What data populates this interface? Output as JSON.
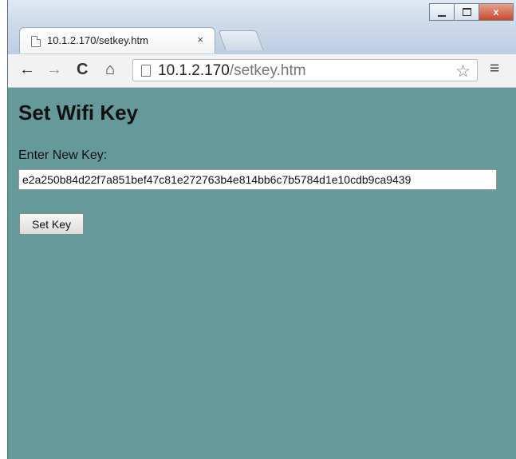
{
  "browser": {
    "tab": {
      "title": "10.1.2.170/setkey.htm",
      "close_label": "×"
    },
    "address_bar": {
      "host": "10.1.2.170",
      "path": "/setkey.htm"
    },
    "window_buttons": {
      "close_label": "x"
    }
  },
  "icons": {
    "back": "←",
    "forward": "→",
    "reload": "C",
    "home": "⌂",
    "star": "☆",
    "menu": "≡"
  },
  "page": {
    "title": "Set Wifi Key",
    "key_label": "Enter New Key:",
    "key_value": "e2a250b84d22f7a851bef47c81e272763b4e814bb6c7b5784d1e10cdb9ca9439",
    "set_button": "Set Key"
  },
  "colors": {
    "page_background": "#669999",
    "window_chrome": "#cfdbea",
    "toolbar": "#f2f2f2"
  }
}
